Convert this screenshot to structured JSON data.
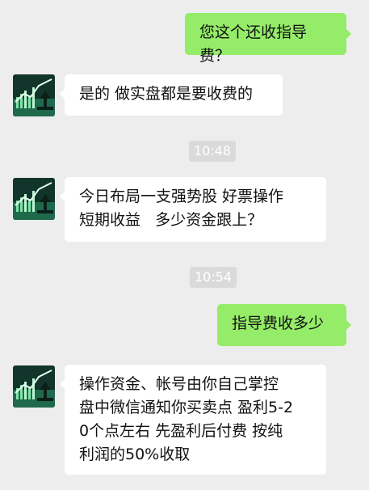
{
  "messages": [
    {
      "side": "right",
      "text": "您这个还收指导费？"
    },
    {
      "side": "left",
      "text": "是的 做实盘都是要收费的"
    },
    {
      "type": "time",
      "text": "10:48"
    },
    {
      "side": "left",
      "text": "今日布局一支强势股 好票操作\n短期收益   多少资金跟上？"
    },
    {
      "type": "time",
      "text": "10:54"
    },
    {
      "side": "right",
      "text": "指导费收多少"
    },
    {
      "side": "left",
      "text": "操作资金、帐号由你自己掌控\n盘中微信通知你买卖点 盈利5-2\n0个点左右 先盈利后付费 按纯\n利润的50%收取"
    }
  ],
  "colors": {
    "background": "#ededed",
    "sent_bubble": "#95ec69",
    "received_bubble": "#ffffff",
    "time_badge": "#dadada"
  },
  "avatar_icon": "stock-chart-avatar-icon"
}
